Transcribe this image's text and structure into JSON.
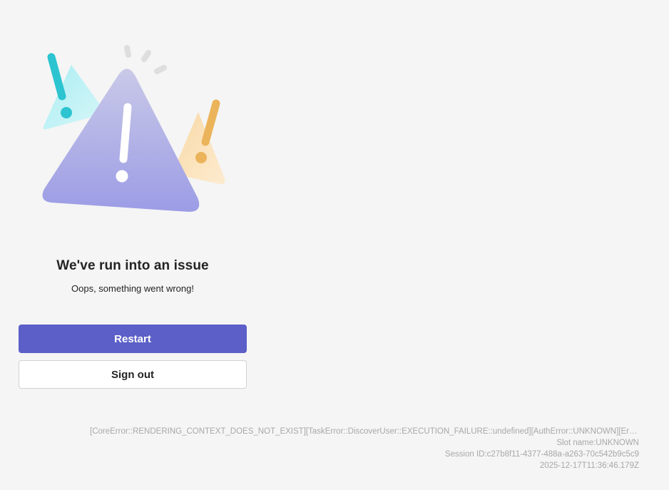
{
  "error": {
    "title": "We've run into an issue",
    "message": "Oops, something went wrong!"
  },
  "actions": {
    "restart_label": "Restart",
    "sign_out_label": "Sign out"
  },
  "diagnostics": {
    "error_codes": "[CoreError::RENDERING_CONTEXT_DOES_NOT_EXIST][TaskError::DiscoverUser::EXECUTION_FAILURE::undefined][AuthError::UNKNOWN][Error::...",
    "slot_name": "Slot name:UNKNOWN",
    "session_id": "Session ID:c27b8f11-4377-488a-a263-70c542b9c5c9",
    "timestamp": "2025-12-17T11:36:46.179Z"
  },
  "illustration": {
    "icon": "warning-triangles-illustration",
    "colors": {
      "main_triangle_top": "#c3c2e6",
      "main_triangle_bottom": "#9e9de6",
      "teal": "#2cc4d0",
      "teal_triangle": "#b8eef2",
      "orange": "#ebb45a",
      "orange_triangle": "#fbe2b9",
      "spark": "#dcdcdc"
    }
  },
  "theme": {
    "background": "#f5f5f5",
    "primary": "#5b5fc7"
  }
}
